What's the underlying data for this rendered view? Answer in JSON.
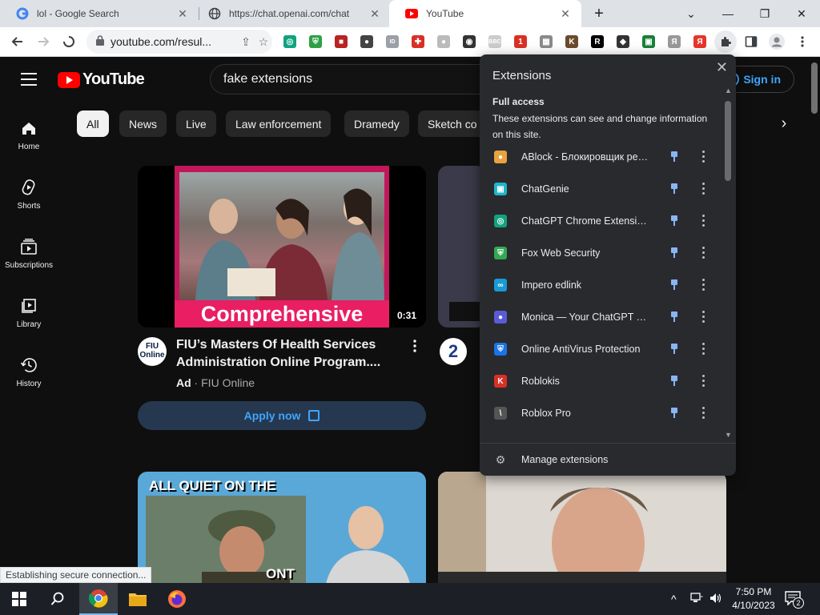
{
  "browser": {
    "tabs": [
      {
        "title": "lol - Google Search",
        "active": false,
        "favicon": "google-g"
      },
      {
        "title": "https://chat.openai.com/chat",
        "active": false,
        "favicon": "globe"
      },
      {
        "title": "YouTube",
        "active": true,
        "favicon": "youtube"
      }
    ],
    "new_tab": "+",
    "window_controls": {
      "minimize": "—",
      "maximize": "❐",
      "close": "✕",
      "tab_search": "⌄"
    },
    "url": "youtube.com/resul...",
    "status_text": "Establishing secure connection..."
  },
  "extension_icons": [
    {
      "name": "chatgpt-ext",
      "color": "#10a37f",
      "glyph": "◎"
    },
    {
      "name": "fox-security",
      "color": "#2ea043",
      "glyph": "⛨"
    },
    {
      "name": "roblox-red",
      "color": "#b22",
      "glyph": "■"
    },
    {
      "name": "hat",
      "color": "#444",
      "glyph": "●"
    },
    {
      "name": "id",
      "color": "#9aa0a6",
      "glyph": "ID"
    },
    {
      "name": "shield-red",
      "color": "#d93025",
      "glyph": "✚"
    },
    {
      "name": "grey-disc",
      "color": "#bbb",
      "glyph": "●"
    },
    {
      "name": "eye",
      "color": "#333",
      "glyph": "◉"
    },
    {
      "name": "bbc",
      "color": "#ccc",
      "glyph": "BBC"
    },
    {
      "name": "badge-1",
      "color": "#d93025",
      "glyph": "1"
    },
    {
      "name": "grid-img",
      "color": "#8a8a8a",
      "glyph": "▦"
    },
    {
      "name": "k-brown",
      "color": "#6b4a2b",
      "glyph": "K"
    },
    {
      "name": "r-black",
      "color": "#000",
      "glyph": "R"
    },
    {
      "name": "cat",
      "color": "#333",
      "glyph": "◆"
    },
    {
      "name": "green-sheet",
      "color": "#188038",
      "glyph": "▣"
    },
    {
      "name": "ya",
      "color": "#999",
      "glyph": "Я"
    },
    {
      "name": "yandex-red",
      "color": "#e8352b",
      "glyph": "Я"
    }
  ],
  "youtube": {
    "logo": "YouTube",
    "search_query": "fake extensions",
    "signin": "Sign in",
    "rail": [
      {
        "label": "Home",
        "icon": "home-icon"
      },
      {
        "label": "Shorts",
        "icon": "shorts-icon"
      },
      {
        "label": "Subscriptions",
        "icon": "subscriptions-icon"
      },
      {
        "label": "Library",
        "icon": "library-icon"
      },
      {
        "label": "History",
        "icon": "history-icon"
      }
    ],
    "chips": [
      "All",
      "News",
      "Live",
      "Law enforcement",
      "Dramedy",
      "Sketch co"
    ],
    "videos": [
      {
        "thumb_caption": "Comprehensive",
        "duration": "0:31",
        "channel_avatar": "FIU Online",
        "title_line1": "FIU’s Masters Of Health Services",
        "title_line2": "Administration Online Program....",
        "ad_label": "Ad",
        "channel": "FIU Online",
        "cta": "Apply now"
      },
      {
        "thumb_caption": "ALL QUIET ON THE",
        "thumb_caption2": "ONT"
      }
    ]
  },
  "extensions_popup": {
    "title": "Extensions",
    "section_title": "Full access",
    "section_desc": "These extensions can see and change information on this site.",
    "items": [
      {
        "name": "ABlock - Блокировщик рек...",
        "color": "#e8a33d",
        "glyph": "●"
      },
      {
        "name": "ChatGenie",
        "color": "#1fb6c9",
        "glyph": "▣"
      },
      {
        "name": "ChatGPT Chrome Extension...",
        "color": "#10a37f",
        "glyph": "◎"
      },
      {
        "name": "Fox Web Security",
        "color": "#34a853",
        "glyph": "⛨"
      },
      {
        "name": "Impero edlink",
        "color": "#1a9ad6",
        "glyph": "∞"
      },
      {
        "name": "Monica — Your ChatGPT Co...",
        "color": "#5b5bd6",
        "glyph": "●"
      },
      {
        "name": "Online AntiVirus Protection",
        "color": "#1a73e8",
        "glyph": "⛨"
      },
      {
        "name": "Roblokis",
        "color": "#d93025",
        "glyph": "K"
      },
      {
        "name": "Roblox Pro",
        "color": "#555",
        "glyph": "\\"
      }
    ],
    "manage": "Manage extensions"
  },
  "taskbar": {
    "time": "7:50 PM",
    "date": "4/10/2023",
    "notification_count": "2"
  }
}
